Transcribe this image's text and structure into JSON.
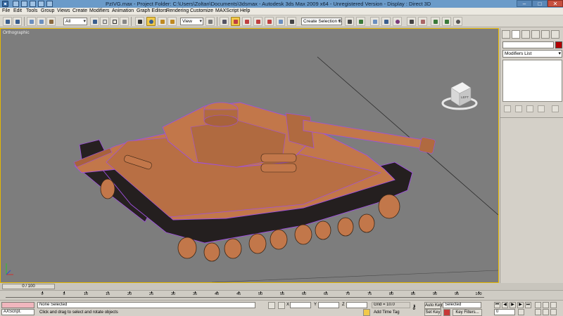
{
  "window": {
    "title": "PzIVG.max    - Project Folder: C:\\Users\\Zoltan\\Documents\\3dsmax    - Autodesk 3ds Max  2009 x64    - Unregistered Version    - Display : Direct 3D",
    "min": "–",
    "max": "□",
    "close": "✕"
  },
  "menu": [
    "File",
    "Edit",
    "Tools",
    "Group",
    "Views",
    "Create",
    "Modifiers",
    "Animation",
    "Graph Editors",
    "Rendering",
    "Customize",
    "MAXScript",
    "Help"
  ],
  "toolbar": {
    "selection_filter": "All",
    "ref_coord": "View",
    "named_selection_placeholder": "Create Selection Set"
  },
  "viewport": {
    "label": "Orthographic",
    "viewcube_face": "LEFT",
    "accent_color": "#e6b800",
    "model_color": "#c2774a",
    "wire_color": "#a050e0"
  },
  "command_panel": {
    "modifier_list": "Modifiers List"
  },
  "time": {
    "slider": "0 / 100",
    "ticks": [
      "0",
      "5",
      "10",
      "15",
      "20",
      "25",
      "30",
      "35",
      "40",
      "45",
      "50",
      "55",
      "60",
      "65",
      "70",
      "75",
      "80",
      "85",
      "90",
      "95",
      "100"
    ]
  },
  "status": {
    "maxscript_label": "AXScript.",
    "selection": "None Selected",
    "prompt": "Click and drag to select and rotate objects",
    "x_label": "X",
    "y_label": "Y",
    "z_label": "Z",
    "grid": "Grid = 10.0",
    "add_time_tag": "Add Time Tag",
    "auto_key": "Auto Key",
    "set_key": "Set Key",
    "key_mode": "Selected",
    "key_filters": "Key Filters...",
    "frame": "0"
  }
}
